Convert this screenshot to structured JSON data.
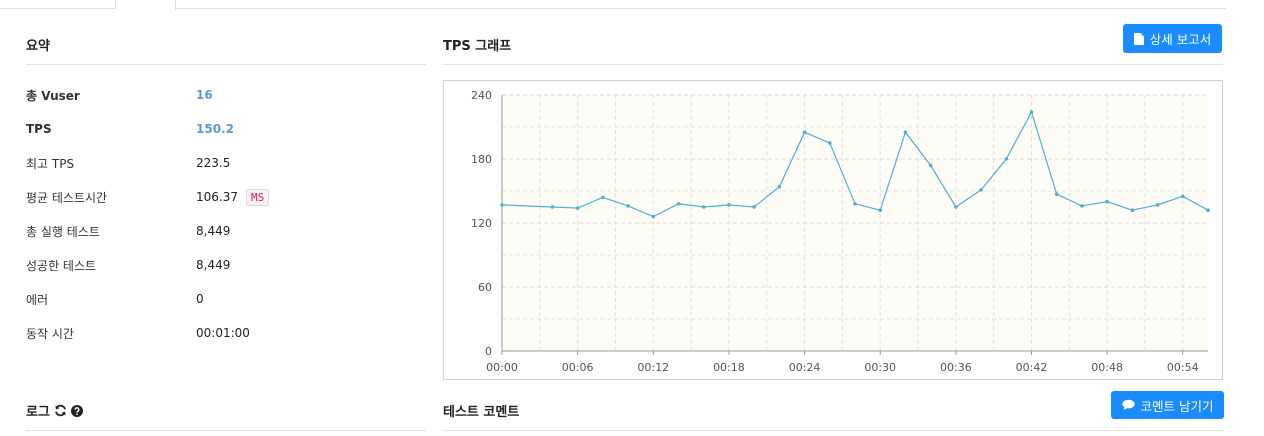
{
  "summary": {
    "title": "요약",
    "rows": [
      {
        "label": "총 Vuser",
        "value": "16"
      },
      {
        "label": "TPS",
        "value": "150.2"
      },
      {
        "label": "최고 TPS",
        "value": "223.5"
      },
      {
        "label": "평균 테스트시간",
        "value": "106.37",
        "unit": "MS"
      },
      {
        "label": "총 실행 테스트",
        "value": "8,449"
      },
      {
        "label": "성공한 테스트",
        "value": "8,449"
      },
      {
        "label": "에러",
        "value": "0"
      },
      {
        "label": "동작 시간",
        "value": "00:01:00"
      }
    ]
  },
  "tps_panel": {
    "title": "TPS 그래프",
    "detail_report_label": "상세 보고서"
  },
  "log": {
    "title": "로그"
  },
  "comment": {
    "title": "테스트 코멘트",
    "leave_comment_label": "코멘트 남기기"
  },
  "colors": {
    "accent": "#1a8cff",
    "link_value": "#5a9bd5",
    "series_line": "#4fb0d6",
    "plot_bg": "#fdfcf5"
  },
  "chart_data": {
    "type": "line",
    "title": "",
    "xlabel": "",
    "ylabel": "",
    "ylim": [
      0,
      240
    ],
    "yticks": [
      0,
      60,
      120,
      180,
      240
    ],
    "xticks": [
      "00:00",
      "00:06",
      "00:12",
      "00:18",
      "00:24",
      "00:30",
      "00:36",
      "00:42",
      "00:48",
      "00:54"
    ],
    "grid": true,
    "series": [
      {
        "x": [
          "00:00",
          "00:04",
          "00:06",
          "00:08",
          "00:10",
          "00:12",
          "00:14",
          "00:16",
          "00:18",
          "00:20",
          "00:22",
          "00:24",
          "00:26",
          "00:28",
          "00:30",
          "00:32",
          "00:34",
          "00:36",
          "00:38",
          "00:40",
          "00:42",
          "00:44",
          "00:46",
          "00:48",
          "00:50",
          "00:52",
          "00:54",
          "00:56"
        ],
        "values": [
          137,
          135,
          134,
          144,
          136,
          126,
          138,
          135,
          137,
          135,
          154,
          205,
          195,
          138,
          132,
          205,
          174,
          135,
          151,
          180,
          224,
          147,
          136,
          140,
          132,
          137,
          145,
          132
        ]
      }
    ]
  }
}
